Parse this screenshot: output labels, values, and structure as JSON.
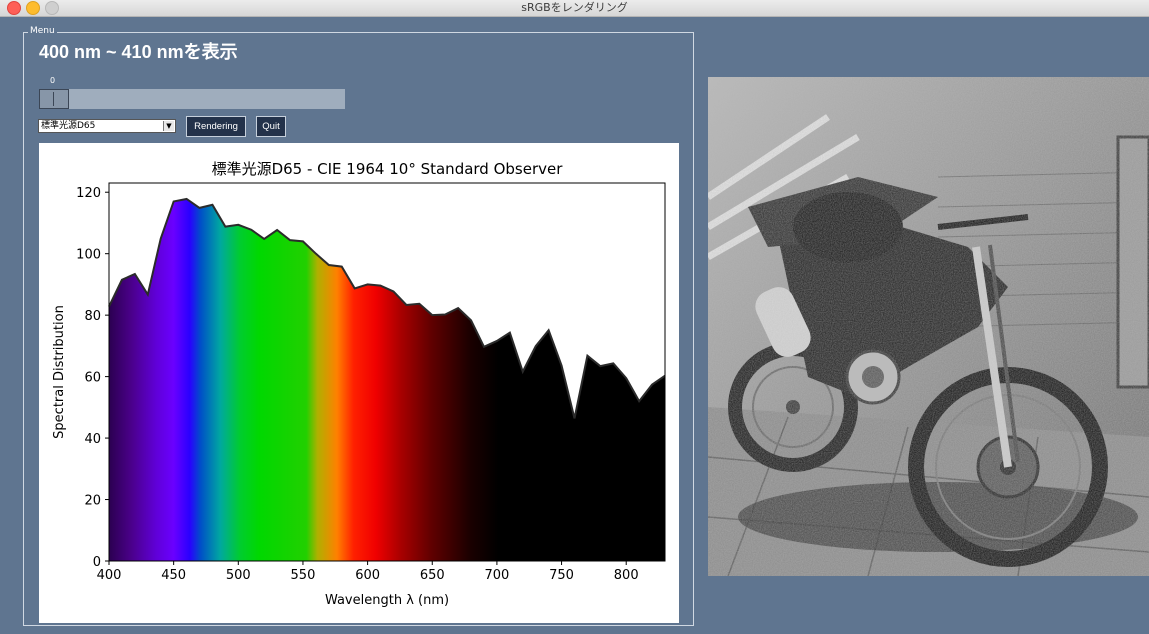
{
  "window": {
    "title": "sRGBをレンダリング"
  },
  "menu": {
    "legend": "Menu",
    "heading": "400 nm ~ 410 nmを表示",
    "slider": {
      "value": "0"
    },
    "illuminant_select": {
      "selected": "標準光源D65"
    },
    "rendering_label": "Rendering",
    "quit_label": "Quit"
  },
  "chart_data": {
    "type": "area",
    "title": "標準光源D65 - CIE 1964 10° Standard Observer",
    "xlabel": "Wavelength λ (nm)",
    "ylabel": "Spectral Distribution",
    "xlim": [
      400,
      830
    ],
    "ylim": [
      0,
      123
    ],
    "x_ticks": [
      400,
      450,
      500,
      550,
      600,
      650,
      700,
      750,
      800
    ],
    "y_ticks": [
      0,
      20,
      40,
      60,
      80,
      100,
      120
    ],
    "x": [
      400,
      410,
      420,
      430,
      440,
      450,
      460,
      470,
      480,
      490,
      500,
      510,
      520,
      530,
      540,
      550,
      560,
      570,
      580,
      590,
      600,
      610,
      620,
      630,
      640,
      650,
      660,
      670,
      680,
      690,
      700,
      710,
      720,
      730,
      740,
      750,
      760,
      770,
      780,
      790,
      800,
      810,
      820,
      830
    ],
    "values": [
      82.8,
      91.5,
      93.4,
      86.7,
      104.9,
      117.0,
      117.8,
      114.9,
      115.9,
      108.8,
      109.4,
      107.8,
      104.8,
      107.7,
      104.4,
      104.0,
      100.0,
      96.3,
      95.8,
      88.7,
      90.0,
      89.6,
      87.7,
      83.3,
      83.7,
      80.0,
      80.2,
      82.3,
      78.3,
      69.7,
      71.6,
      74.3,
      61.6,
      69.9,
      75.1,
      63.6,
      46.4,
      66.8,
      63.4,
      64.3,
      59.5,
      52.0,
      57.4,
      60.3
    ],
    "fill": "visible-spectrum gradient; black beyond ~700 nm",
    "grid": false
  },
  "photo": {
    "description": "grayscale render: motorcycle"
  }
}
